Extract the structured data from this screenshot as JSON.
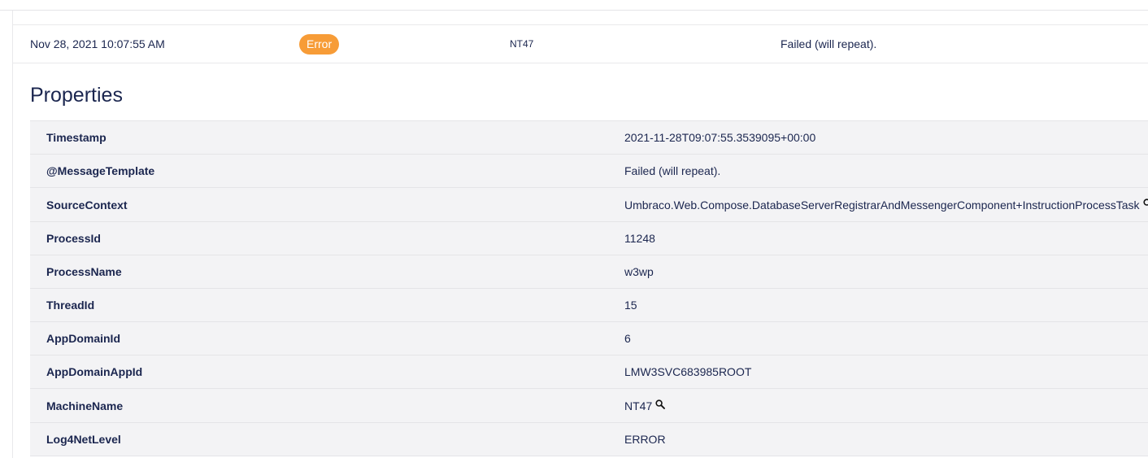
{
  "log_entry": {
    "timestamp": "Nov 28, 2021 10:07:55 AM",
    "level": "Error",
    "machine": "NT47",
    "message": "Failed (will repeat)."
  },
  "properties": {
    "title": "Properties",
    "rows": [
      {
        "key": "Timestamp",
        "value": "2021-11-28T09:07:55.3539095+00:00"
      },
      {
        "key": "@MessageTemplate",
        "value": "Failed (will repeat)."
      },
      {
        "key": "SourceContext",
        "value": "Umbraco.Web.Compose.DatabaseServerRegistrarAndMessengerComponent+InstructionProcessTask",
        "icon": "search-icon"
      },
      {
        "key": "ProcessId",
        "value": "11248"
      },
      {
        "key": "ProcessName",
        "value": "w3wp"
      },
      {
        "key": "ThreadId",
        "value": "15"
      },
      {
        "key": "AppDomainId",
        "value": "6"
      },
      {
        "key": "AppDomainAppId",
        "value": "LMW3SVC683985ROOT"
      },
      {
        "key": "MachineName",
        "value": "NT47",
        "icon": "search-icon"
      },
      {
        "key": "Log4NetLevel",
        "value": "ERROR"
      }
    ]
  },
  "colors": {
    "accent_error": "#f79c37",
    "text": "#1b264f",
    "table_background": "#f3f3f5"
  }
}
